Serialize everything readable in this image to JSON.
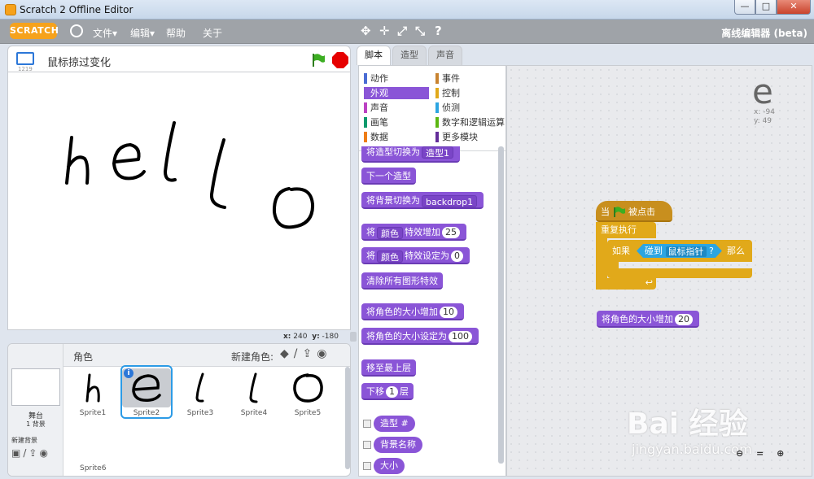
{
  "window": {
    "title": "Scratch 2 Offline Editor",
    "min": "—",
    "max": "□",
    "close": "✕"
  },
  "menubar": {
    "logo": "SCRATCH",
    "items": [
      "文件▾",
      "编辑▾",
      "帮助",
      "关于"
    ],
    "tools": [
      "✥",
      "✛",
      "⤢",
      "⤡",
      "?"
    ],
    "editor_label": "离线编辑器 (beta)"
  },
  "stage": {
    "project_name": "鼠标掠过变化",
    "version": "1219",
    "drawing_text": [
      "h",
      "e",
      "l",
      "l",
      "o"
    ],
    "mouse_x_label": "x:",
    "mouse_x": "240",
    "mouse_y_label": "y:",
    "mouse_y": "-180"
  },
  "sprites": {
    "header_label": "角色",
    "new_sprite_label": "新建角色:",
    "new_icons": [
      "◆",
      "/",
      "⇪",
      "◉"
    ],
    "stage_name": "舞台",
    "stage_bg_count": "1 背景",
    "new_backdrop_label": "新建背景",
    "bg_icons": [
      "▣",
      "/",
      "⇪",
      "◉"
    ],
    "items": [
      {
        "name": "Sprite1",
        "glyph": "h"
      },
      {
        "name": "Sprite2",
        "glyph": "e",
        "selected": true
      },
      {
        "name": "Sprite3",
        "glyph": "l"
      },
      {
        "name": "Sprite4",
        "glyph": "l"
      },
      {
        "name": "Sprite5",
        "glyph": "o"
      }
    ],
    "extra": "Sprite6",
    "info_icon": "i"
  },
  "tabs": [
    "脚本",
    "造型",
    "声音"
  ],
  "categories": {
    "left": [
      {
        "label": "动作",
        "color": "#4a6cd4"
      },
      {
        "label": "外观",
        "color": "#8a55d7",
        "active": true
      },
      {
        "label": "声音",
        "color": "#bb42c3"
      },
      {
        "label": "画笔",
        "color": "#0e9a6c"
      },
      {
        "label": "数据",
        "color": "#ee7d16"
      }
    ],
    "right": [
      {
        "label": "事件",
        "color": "#c88330"
      },
      {
        "label": "控制",
        "color": "#e1a91a"
      },
      {
        "label": "侦测",
        "color": "#2ca5e2"
      },
      {
        "label": "数字和逻辑运算",
        "color": "#5cb712"
      },
      {
        "label": "更多模块",
        "color": "#632d99"
      }
    ]
  },
  "palette": {
    "b0": "将造型切换为",
    "b0dd": "造型1",
    "b1": "下一个造型",
    "b2": "将背景切换为",
    "b2dd": "backdrop1",
    "b3a": "将",
    "b3dd": "颜色",
    "b3b": "特效增加",
    "b3v": "25",
    "b4a": "将",
    "b4dd": "颜色",
    "b4b": "特效设定为",
    "b4v": "0",
    "b5": "清除所有图形特效",
    "b6": "将角色的大小增加",
    "b6v": "10",
    "b7": "将角色的大小设定为",
    "b7v": "100",
    "b8": "移至最上层",
    "b9a": "下移",
    "b9v": "1",
    "b9b": "层",
    "r1": "造型 #",
    "r2": "背景名称",
    "r3": "大小"
  },
  "script": {
    "hat_a": "当",
    "hat_b": "被点击",
    "forever": "重复执行",
    "if": "如果",
    "touching": "碰到",
    "target": "鼠标指针",
    "q": "?",
    "then": "那么",
    "loop_arrow": "↩",
    "loose_block": "将角色的大小增加",
    "loose_value": "20",
    "corner_glyph": "e",
    "corner_x": "x: -94",
    "corner_y": "y: 49"
  },
  "zoom": {
    "controls": "⊖ = ⊕"
  },
  "watermark": {
    "main": "Bai 经验",
    "url": "jingyan.baidu.com"
  }
}
